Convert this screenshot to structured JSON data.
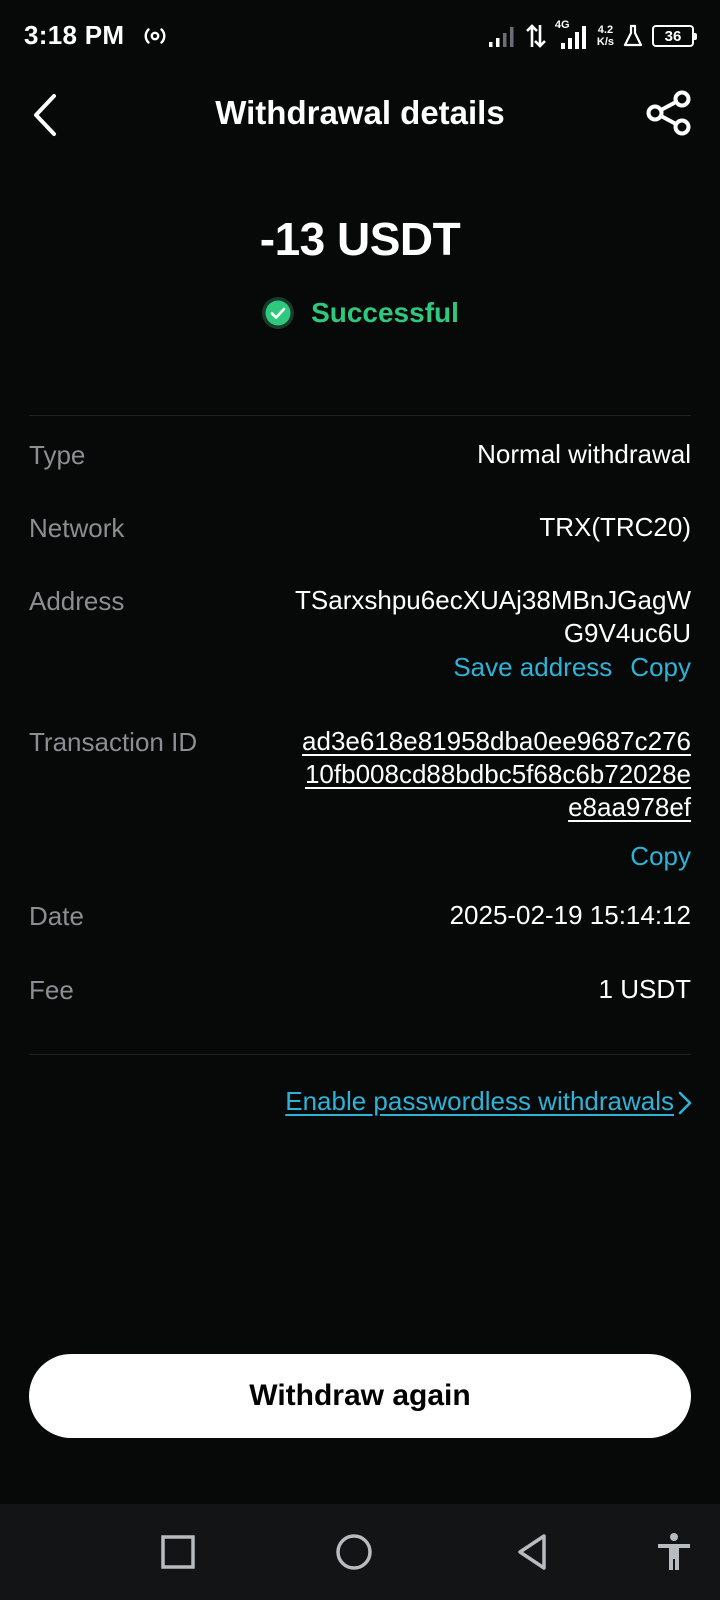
{
  "status_bar": {
    "time": "3:18 PM",
    "net_type": "4G",
    "speed_value": "4.2",
    "speed_unit": "K/s",
    "battery": "36"
  },
  "header": {
    "title": "Withdrawal details"
  },
  "summary": {
    "amount": "-13 USDT",
    "status": "Successful",
    "status_color": "#2ec97e"
  },
  "details": {
    "type_label": "Type",
    "type_value": "Normal withdrawal",
    "network_label": "Network",
    "network_value": "TRX(TRC20)",
    "address_label": "Address",
    "address_value": "TSarxshpu6ecXUAj38MBnJGagWG9V4uc6U",
    "save_address": "Save address",
    "copy_address": "Copy",
    "txid_label": "Transaction ID",
    "txid_value": "ad3e618e81958dba0ee9687c27610fb008cd88bdbc5f68c6b72028ee8aa978ef",
    "copy_txid": "Copy",
    "date_label": "Date",
    "date_value": "2025-02-19 15:14:12",
    "fee_label": "Fee",
    "fee_value": "1 USDT"
  },
  "passwordless_link": "Enable passwordless withdrawals",
  "withdraw_again": "Withdraw again",
  "colors": {
    "background": "#070808",
    "accent_link": "#2db3d7",
    "success": "#2ec97e"
  }
}
